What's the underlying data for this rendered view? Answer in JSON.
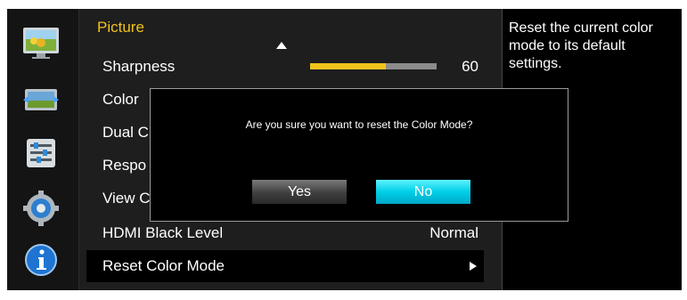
{
  "menu": {
    "title": "Picture",
    "items": [
      {
        "label": "Sharpness",
        "value": "60",
        "bar_fraction": 0.6
      },
      {
        "label": "Color",
        "value": ""
      },
      {
        "label": "Dual C",
        "value": ""
      },
      {
        "label": "Respo",
        "value": ""
      },
      {
        "label": "View C",
        "value": ""
      },
      {
        "label": "HDMI Black Level",
        "value": "Normal"
      },
      {
        "label": "Reset Color Mode",
        "value": ""
      }
    ]
  },
  "help": {
    "text": "Reset the current color mode to its default settings."
  },
  "dialog": {
    "message": "Are you sure you want to reset the Color Mode?",
    "yes_label": "Yes",
    "no_label": "No"
  },
  "rail": {
    "icons": [
      "picture-icon",
      "screen-size-icon",
      "settings-menu-icon",
      "setup-gear-icon",
      "information-icon"
    ]
  },
  "colors": {
    "accent": "#f2c31c",
    "highlight": "#00d2e8"
  }
}
